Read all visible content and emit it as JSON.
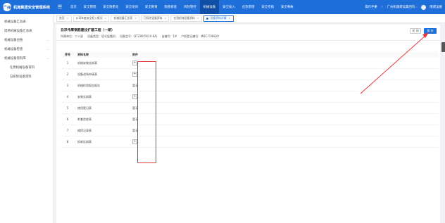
{
  "app": {
    "logo_text": "广州",
    "title": "机施集团安全管理系统"
  },
  "nav": [
    "首页",
    "安全管理",
    "安全隐患化",
    "安全培训",
    "安全教育",
    "隐患排查",
    "风险管控",
    "机械设备",
    "安全投入",
    "应急管理",
    "安全考核",
    "安全事故"
  ],
  "nav_active_index": 7,
  "top_right": {
    "manual": "操作手册",
    "org": "广州机施建设集团有...",
    "user": "隆建运维"
  },
  "sidebar": [
    {
      "label": "机械设备汇总表",
      "expandable": false,
      "sub": false
    },
    {
      "label": "塔吊机械设备汇总表",
      "expandable": false,
      "sub": false
    },
    {
      "label": "机械设备台账",
      "expandable": true,
      "sub": false
    },
    {
      "label": "机械设备检查",
      "expandable": true,
      "sub": false
    },
    {
      "label": "机械设备资料库",
      "expandable": true,
      "sub": false
    },
    {
      "label": "在用机械设备资料",
      "expandable": false,
      "sub": true
    },
    {
      "label": "已拆除设备资料",
      "expandable": false,
      "sub": true
    }
  ],
  "tabs": [
    {
      "label": "首页",
      "active": false,
      "closable": true
    },
    {
      "label": "公司年度安全投入情况",
      "active": false,
      "closable": true
    },
    {
      "label": "机械设备汇总表",
      "active": false,
      "closable": true
    },
    {
      "label": "已拆除设备资料",
      "active": false,
      "closable": true
    },
    {
      "label": "在用机械设备资料",
      "active": false,
      "closable": true
    },
    {
      "label": "设备资料详情",
      "active": true,
      "closable": true
    }
  ],
  "page": {
    "title": "云浮伟厚钢筋建设扩建工程（一期）",
    "info": [
      "所属单位：二十部",
      "设备类型：塔式起重机",
      "设备型号：QTZ80(5610-6A)",
      "自编号：1#",
      "产权登记编号：粤EC-T06820"
    ],
    "close_label": "关 闭",
    "save_label": "保 存"
  },
  "table": {
    "headers": [
      "序号",
      "资料名称",
      "附件"
    ],
    "rows": [
      {
        "no": "1",
        "name": "机械安装告知表",
        "attachment": "+"
      },
      {
        "no": "2",
        "name": "设备进场申请表",
        "attachment": "+"
      },
      {
        "no": "3",
        "name": "机械检验报告报告",
        "attachment": "暂无"
      },
      {
        "no": "4",
        "name": "安装告知表",
        "attachment": "+"
      },
      {
        "no": "5",
        "name": "使用登记表",
        "attachment": "暂无"
      },
      {
        "no": "6",
        "name": "附着验收表",
        "attachment": "暂无"
      },
      {
        "no": "7",
        "name": "维保记录表",
        "attachment": "暂无"
      },
      {
        "no": "8",
        "name": "拆卸告知表",
        "attachment": "+"
      }
    ]
  },
  "colors": {
    "primary": "#1e6fd9",
    "highlight": "#e03b3b"
  }
}
